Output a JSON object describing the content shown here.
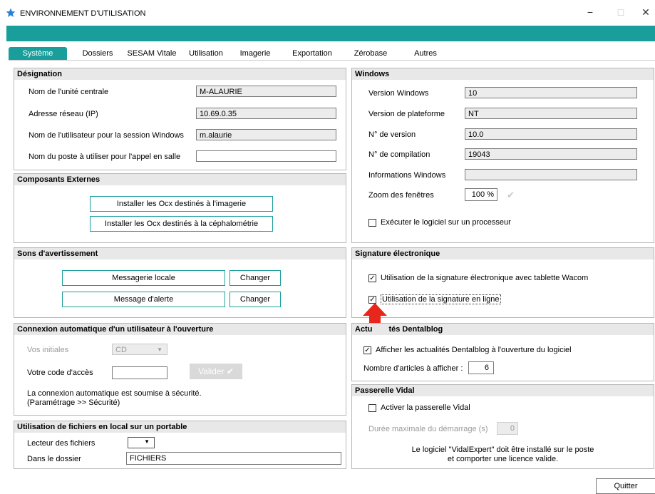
{
  "window": {
    "title": "ENVIRONNEMENT D'UTILISATION",
    "min": "−",
    "max": "□",
    "close": "✕",
    "accent": "#1a9e9b"
  },
  "tabs": [
    "Système",
    "Dossiers",
    "SESAM Vitale",
    "Utilisation",
    "Imagerie",
    "Exportation",
    "Zérobase",
    "Autres"
  ],
  "designation": {
    "header": "Désignation",
    "rows": [
      {
        "label": "Nom de l'unité centrale",
        "value": "M-ALAURIE"
      },
      {
        "label": "Adresse réseau (IP)",
        "value": "10.69.0.35"
      },
      {
        "label": "Nom de l'utilisateur pour la session Windows",
        "value": "m.alaurie"
      },
      {
        "label": "Nom du poste à utiliser pour l'appel en salle",
        "value": ""
      }
    ]
  },
  "composants": {
    "header": "Composants Externes",
    "btn_imagerie": "Installer les Ocx destinés à l'imagerie",
    "btn_cephalo": "Installer les Ocx destinés à la céphalométrie"
  },
  "sons": {
    "header": "Sons d'avertissement",
    "messagerie": "Messagerie locale",
    "alerte": "Message d'alerte",
    "changer": "Changer"
  },
  "connexion": {
    "header": "Connexion automatique d'un utilisateur à l'ouverture",
    "initiales_label": "Vos initiales",
    "initiales_value": "CD",
    "code_label": "Votre code d'accès",
    "valider": "Valider",
    "note1": "La connexion automatique est soumise à sécurité.",
    "note2": "(Paramétrage >> Sécurité)"
  },
  "fichiers": {
    "header": "Utilisation de fichiers en local sur un portable",
    "lecteur_label": "Lecteur des fichiers",
    "dossier_label": "Dans le dossier",
    "dossier_value": "FICHIERS"
  },
  "windows": {
    "header": "Windows",
    "rows": [
      {
        "label": "Version Windows",
        "value": "10"
      },
      {
        "label": "Version de plateforme",
        "value": "NT"
      },
      {
        "label": "N° de version",
        "value": "10.0"
      },
      {
        "label": "N° de compilation",
        "value": "19043"
      },
      {
        "label": "Informations Windows",
        "value": ""
      }
    ],
    "zoom_label": "Zoom des fenêtres",
    "zoom_value": "100 %",
    "processeur": "Exécuter le logiciel sur un processeur"
  },
  "signature": {
    "header": "Signature électronique",
    "wacom": "Utilisation de la signature électronique avec tablette Wacom",
    "enligne": "Utilisation de la signature en ligne"
  },
  "dentalblog": {
    "header": "Actualités Dentalblog",
    "header_visible": "Actu",
    "header_visible2": "tés Dentalblog",
    "afficher": "Afficher les actualités Dentalblog à l'ouverture du logiciel",
    "nombre_label": "Nombre d'articles à afficher :",
    "nombre_value": "6"
  },
  "vidal": {
    "header": "Passerelle Vidal",
    "activer": "Activer la passerelle Vidal",
    "duree_label": "Durée maximale du démarrage (s)",
    "duree_value": "0",
    "note1": "Le logiciel \"VidalExpert\" doit être installé sur le poste",
    "note2": "et comporter une licence valide."
  },
  "quitter": "Quitter"
}
